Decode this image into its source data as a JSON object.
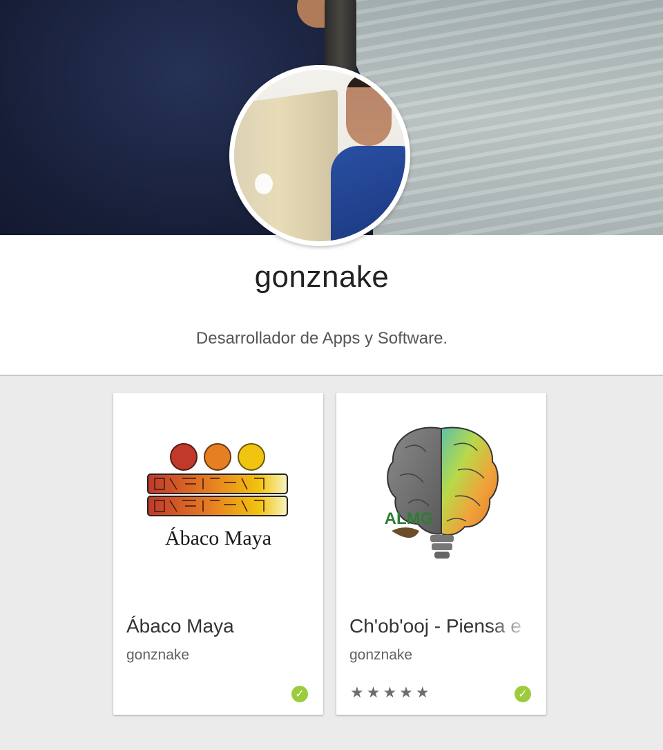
{
  "profile": {
    "name": "gonznake",
    "description": "Desarrollador de Apps y Software."
  },
  "apps": [
    {
      "title": "Ábaco Maya",
      "developer": "gonznake",
      "art_caption": "Ábaco Maya",
      "badge_icon": "verified-check-icon",
      "badge_color": "#9ccc3c"
    },
    {
      "title": "Ch'ob'ooj - Piensa e",
      "developer": "gonznake",
      "art_caption": "ALMG",
      "rating_stars": "★★★★★",
      "badge_icon": "verified-check-icon",
      "badge_color": "#9ccc3c"
    }
  ],
  "icons": {
    "check": "✓"
  }
}
